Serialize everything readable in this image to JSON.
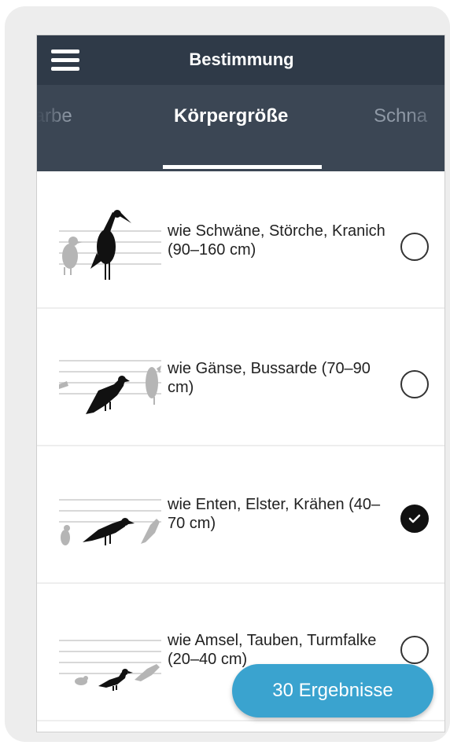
{
  "header": {
    "title": "Bestimmung"
  },
  "tabs": [
    {
      "label": "rfarbe"
    },
    {
      "label": "Körpergröße"
    },
    {
      "label": "Schna"
    }
  ],
  "options": [
    {
      "label": "wie Schwäne, Störche, Kranich (90–160 cm)",
      "selected": false
    },
    {
      "label": "wie Gänse, Bussarde (70–90 cm)",
      "selected": false
    },
    {
      "label": "wie Enten, Elster, Krähen (40–70 cm)",
      "selected": true
    },
    {
      "label": "wie Amsel, Tauben, Turmfalke (20–40 cm)",
      "selected": false
    }
  ],
  "results_button": {
    "label": "30 Ergebnisse"
  },
  "colors": {
    "header": "#2f3a48",
    "tabbar": "#3b4654",
    "accent": "#3aa3cf"
  },
  "icons": [
    "menu-icon",
    "bird-size-illustration",
    "radio-icon",
    "check-icon"
  ]
}
